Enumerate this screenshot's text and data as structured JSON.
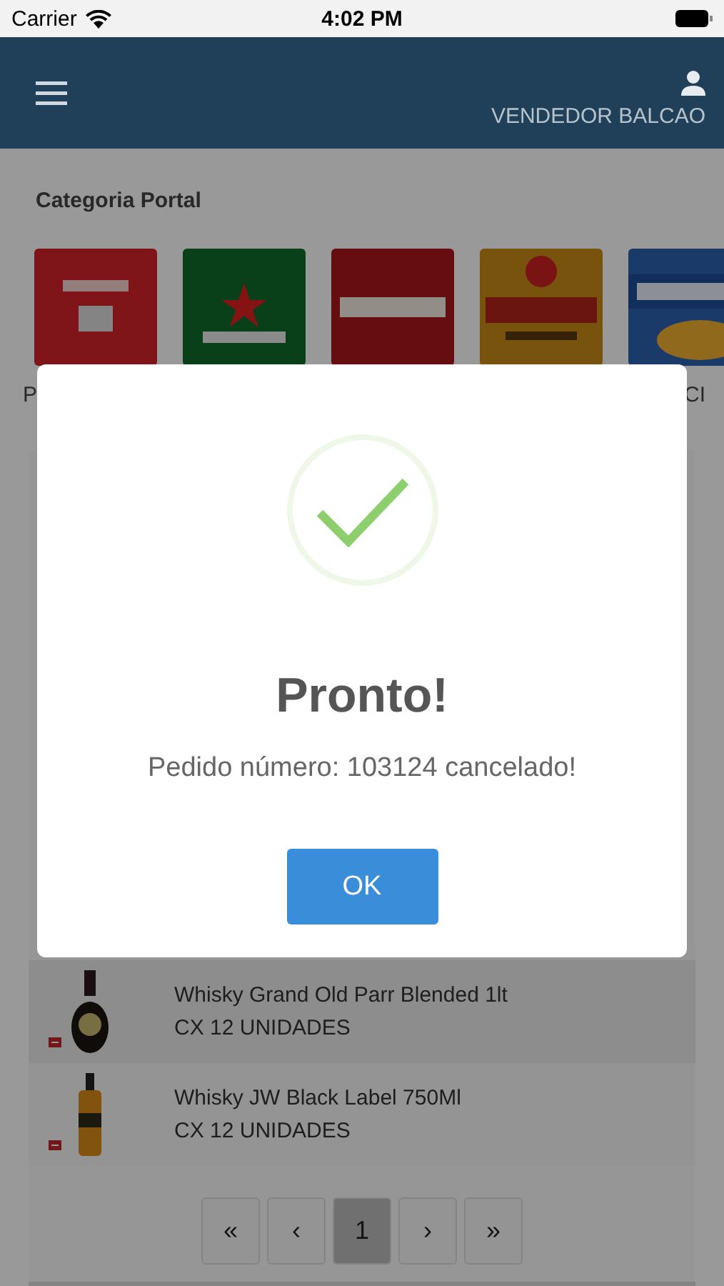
{
  "status_bar": {
    "carrier": "Carrier",
    "time": "4:02 PM"
  },
  "header": {
    "user": "VENDEDOR BALCAO"
  },
  "category_section": {
    "title": "Categoria Portal",
    "categories": [
      {
        "kind": "picture",
        "label": "P"
      },
      {
        "kind": "picture"
      },
      {
        "kind": "picture"
      },
      {
        "kind": "picture"
      },
      {
        "kind": "picture",
        "label": "CI"
      }
    ]
  },
  "products": [
    {
      "name": "Whisky Grand Old Parr Blended 1lt",
      "unit": "CX 12 UNIDADES"
    },
    {
      "name": "Whisky JW Black Label 750Ml",
      "unit": "CX 12 UNIDADES"
    }
  ],
  "pagination": [
    {
      "label": "«",
      "selected": false
    },
    {
      "label": "‹",
      "selected": false
    },
    {
      "label": "1",
      "selected": true
    },
    {
      "label": "›",
      "selected": false
    },
    {
      "label": "»",
      "selected": false
    }
  ],
  "dialog": {
    "title": "Pronto!",
    "message": "Pedido número: 103124 cancelado!",
    "button": "OK"
  }
}
